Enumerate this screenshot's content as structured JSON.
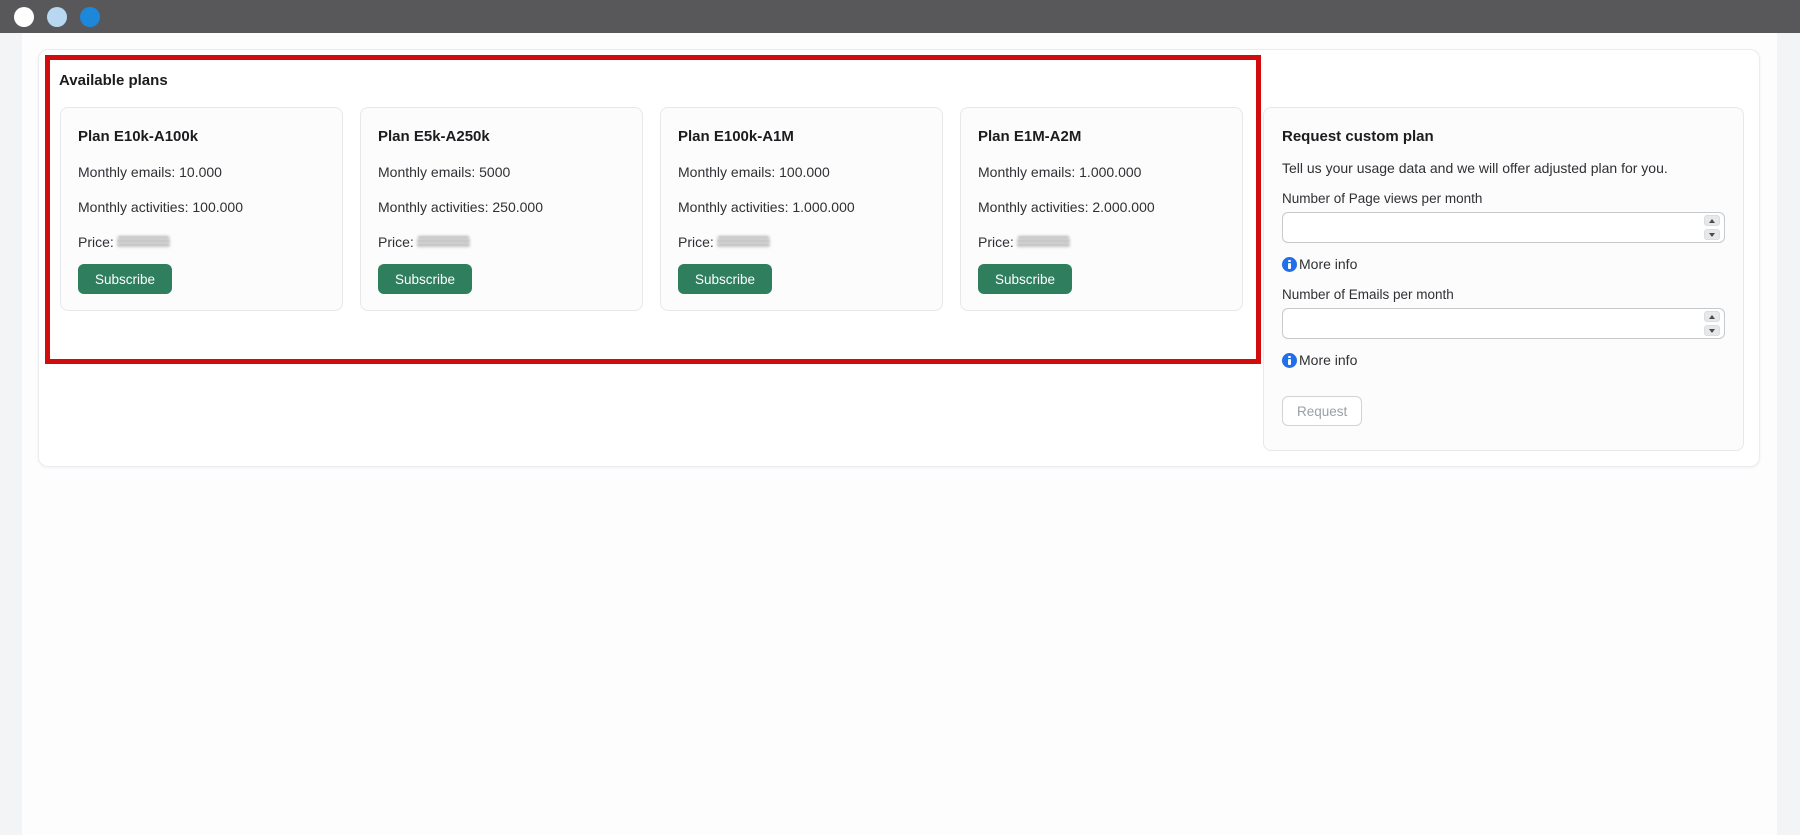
{
  "window_controls": {
    "items": [
      "white-circle",
      "light-blue-circle",
      "blue-circle"
    ]
  },
  "available_plans": {
    "title": "Available plans",
    "plans": [
      {
        "name": "Plan E10k-A100k",
        "monthly_emails": "Monthly emails: 10.000",
        "monthly_activities": "Monthly activities: 100.000",
        "price_label": "Price:",
        "price_redacted": true,
        "cta": "Subscribe"
      },
      {
        "name": "Plan E5k-A250k",
        "monthly_emails": "Monthly emails: 5000",
        "monthly_activities": "Monthly activities: 250.000",
        "price_label": "Price:",
        "price_redacted": true,
        "cta": "Subscribe"
      },
      {
        "name": "Plan E100k-A1M",
        "monthly_emails": "Monthly emails: 100.000",
        "monthly_activities": "Monthly activities: 1.000.000",
        "price_label": "Price:",
        "price_redacted": true,
        "cta": "Subscribe"
      },
      {
        "name": "Plan E1M-A2M",
        "monthly_emails": "Monthly emails: 1.000.000",
        "monthly_activities": "Monthly activities: 2.000.000",
        "price_label": "Price:",
        "price_redacted": true,
        "cta": "Subscribe"
      }
    ]
  },
  "custom_plan": {
    "title": "Request custom plan",
    "description": "Tell us your usage data and we will offer adjusted plan for you.",
    "page_views": {
      "label": "Number of Page views per month",
      "value": "",
      "more_info": "More info"
    },
    "emails": {
      "label": "Number of Emails per month",
      "value": "",
      "more_info": "More info"
    },
    "request_label": "Request"
  },
  "colors": {
    "topbar_gray": "#58585a",
    "accent_green": "#2f7e5e",
    "annotation_red": "#d20c0c",
    "info_blue": "#2170e8",
    "window_circle_light_blue": "#b8d8f1",
    "window_circle_blue": "#1d87d9"
  }
}
